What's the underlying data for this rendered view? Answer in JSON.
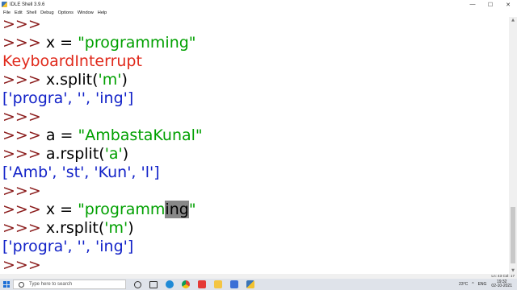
{
  "window": {
    "title": "IDLE Shell 3.9.6",
    "minimize": "—",
    "maximize": "☐",
    "close": "✕"
  },
  "menu": [
    "File",
    "Edit",
    "Shell",
    "Debug",
    "Options",
    "Window",
    "Help"
  ],
  "shell": {
    "prompt": ">>> ",
    "lines": [
      {
        "kind": "prompt",
        "code": ""
      },
      {
        "kind": "prompt",
        "code": "x = ",
        "string": "\"programming\""
      },
      {
        "kind": "error",
        "text": "KeyboardInterrupt"
      },
      {
        "kind": "prompt",
        "code": "x.split(",
        "string": "'m'",
        "code2": ")"
      },
      {
        "kind": "output",
        "text": "['progra', '', 'ing']"
      },
      {
        "kind": "prompt",
        "code": ""
      },
      {
        "kind": "prompt",
        "code": "a = ",
        "string": "\"AmbastaKunal\""
      },
      {
        "kind": "prompt",
        "code": "a.rsplit(",
        "string": "'a'",
        "code2": ")"
      },
      {
        "kind": "output",
        "text": "['Amb', 'st', 'Kun', 'l']"
      },
      {
        "kind": "prompt",
        "code": ""
      },
      {
        "kind": "prompt",
        "code": "x = ",
        "string_pre": "\"programm",
        "string_sel": "ing",
        "string_post": "\""
      },
      {
        "kind": "prompt",
        "code": "x.rsplit(",
        "string": "'m'",
        "code2": ")"
      },
      {
        "kind": "output",
        "text": "['progra', '', 'ing']"
      },
      {
        "kind": "prompt",
        "code": ""
      }
    ]
  },
  "status": {
    "position": "Ln: 43   Col: 17"
  },
  "taskbar": {
    "search_placeholder": "Type here to search",
    "weather": "23°C",
    "tray_up": "^",
    "language": "ENG",
    "time": "19:32",
    "date": "02-10-2021"
  },
  "colors": {
    "prompt": "#8b1c1c",
    "string": "#00a000",
    "error": "#e0291b",
    "output": "#1222c8"
  },
  "icons": [
    "windows-logo-icon",
    "search-icon",
    "cortana-icon",
    "task-view-icon",
    "edge-icon",
    "chrome-icon",
    "youtube-icon",
    "file-explorer-icon",
    "store-icon",
    "python-icon"
  ]
}
